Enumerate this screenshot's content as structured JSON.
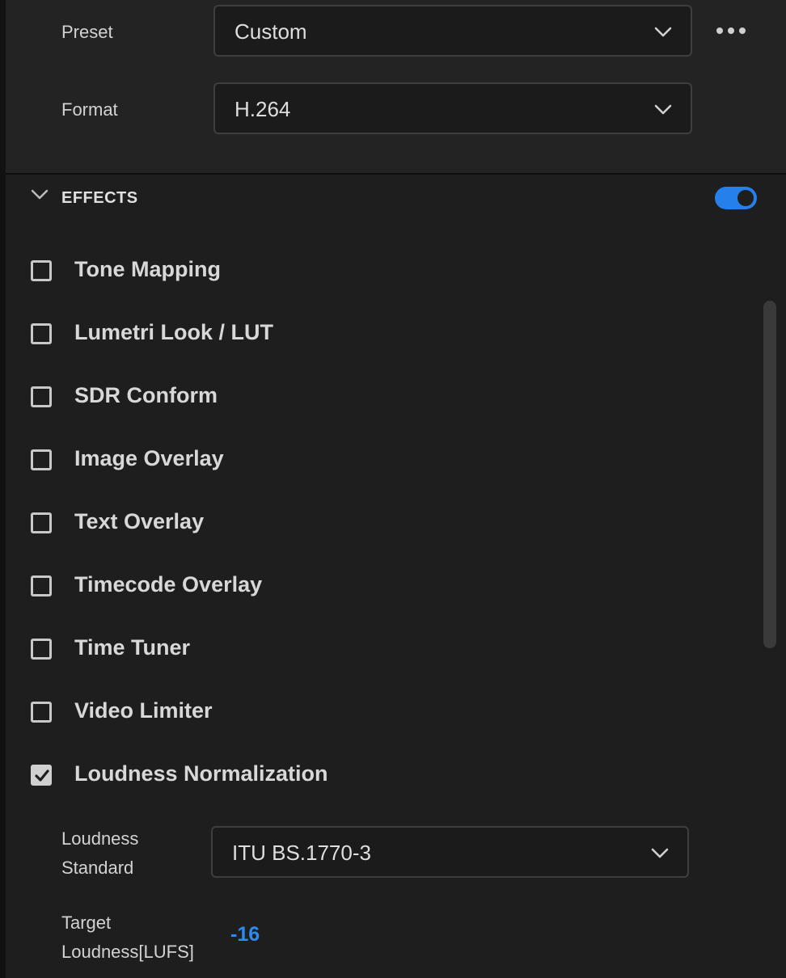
{
  "export": {
    "preset_label": "Preset",
    "preset_value": "Custom",
    "format_label": "Format",
    "format_value": "H.264"
  },
  "effects": {
    "section_title": "EFFECTS",
    "enabled": true,
    "items": [
      {
        "label": "Tone Mapping",
        "checked": false
      },
      {
        "label": "Lumetri Look / LUT",
        "checked": false
      },
      {
        "label": "SDR Conform",
        "checked": false
      },
      {
        "label": "Image Overlay",
        "checked": false
      },
      {
        "label": "Text Overlay",
        "checked": false
      },
      {
        "label": "Timecode Overlay",
        "checked": false
      },
      {
        "label": "Time Tuner",
        "checked": false
      },
      {
        "label": "Video Limiter",
        "checked": false
      },
      {
        "label": "Loudness Normalization",
        "checked": true
      }
    ],
    "loudness": {
      "standard_label_line1": "Loudness",
      "standard_label_line2": "Standard",
      "standard_value": "ITU BS.1770-3",
      "target_label_line1": "Target",
      "target_label_line2": "Loudness[LUFS]",
      "target_value": "-16"
    }
  },
  "colors": {
    "accent": "#2680eb",
    "value_blue": "#2b8bf2",
    "background": "#1e1e1e"
  },
  "icons": {
    "dropdown": "chevron-down-icon",
    "more": "more-icon",
    "section": "chevron-down-icon",
    "check": "checkmark-icon"
  }
}
